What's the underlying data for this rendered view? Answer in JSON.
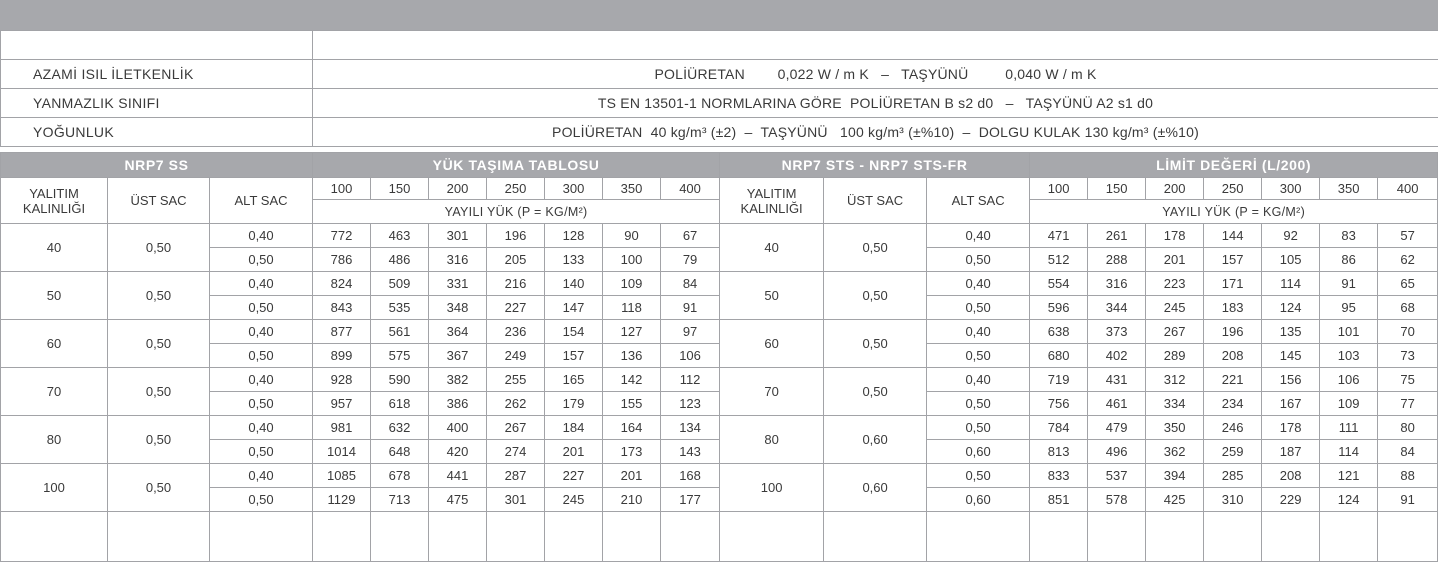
{
  "properties": [
    {
      "label": "AZAMİ ISIL İLETKENLİK",
      "value": "POLİÜRETAN        0,022 W / m K   –   TAŞYÜNÜ         0,040 W / m K"
    },
    {
      "label": "YANMAZLIK SINIFI",
      "value": "TS EN 13501-1 NORMLARINA GÖRE  POLİÜRETAN B s2 d0   –   TAŞYÜNÜ A2 s1 d0"
    },
    {
      "label": "YOĞUNLUK",
      "value": "POLİÜRETAN  40 kg/m³ (±2)  –  TAŞYÜNÜ   100 kg/m³ (±%10)  –  DOLGU KULAK 130 kg/m³ (±%10)"
    }
  ],
  "headers": {
    "left_product": "NRP7 SS",
    "left_table": "YÜK TAŞIMA TABLOSU",
    "right_product": "NRP7 STS - NRP7 STS-FR",
    "right_table": "LİMİT DEĞERİ (L/200)",
    "insulation": "YALITIM KALINLIĞI",
    "top_sheet": "ÜST SAC",
    "bottom_sheet": "ALT SAC",
    "spans": [
      "100",
      "150",
      "200",
      "250",
      "300",
      "350",
      "400"
    ],
    "load_label": "YAYILI YÜK (P = KG/M²)"
  },
  "left_groups": [
    {
      "thickness": "40",
      "top": "0,50",
      "rows": [
        {
          "bottom": "0,40",
          "values": [
            "772",
            "463",
            "301",
            "196",
            "128",
            "90",
            "67"
          ]
        },
        {
          "bottom": "0,50",
          "values": [
            "786",
            "486",
            "316",
            "205",
            "133",
            "100",
            "79"
          ]
        }
      ]
    },
    {
      "thickness": "50",
      "top": "0,50",
      "rows": [
        {
          "bottom": "0,40",
          "values": [
            "824",
            "509",
            "331",
            "216",
            "140",
            "109",
            "84"
          ]
        },
        {
          "bottom": "0,50",
          "values": [
            "843",
            "535",
            "348",
            "227",
            "147",
            "118",
            "91"
          ]
        }
      ]
    },
    {
      "thickness": "60",
      "top": "0,50",
      "rows": [
        {
          "bottom": "0,40",
          "values": [
            "877",
            "561",
            "364",
            "236",
            "154",
            "127",
            "97"
          ]
        },
        {
          "bottom": "0,50",
          "values": [
            "899",
            "575",
            "367",
            "249",
            "157",
            "136",
            "106"
          ]
        }
      ]
    },
    {
      "thickness": "70",
      "top": "0,50",
      "rows": [
        {
          "bottom": "0,40",
          "values": [
            "928",
            "590",
            "382",
            "255",
            "165",
            "142",
            "112"
          ]
        },
        {
          "bottom": "0,50",
          "values": [
            "957",
            "618",
            "386",
            "262",
            "179",
            "155",
            "123"
          ]
        }
      ]
    },
    {
      "thickness": "80",
      "top": "0,50",
      "rows": [
        {
          "bottom": "0,40",
          "values": [
            "981",
            "632",
            "400",
            "267",
            "184",
            "164",
            "134"
          ]
        },
        {
          "bottom": "0,50",
          "values": [
            "1014",
            "648",
            "420",
            "274",
            "201",
            "173",
            "143"
          ]
        }
      ]
    },
    {
      "thickness": "100",
      "top": "0,50",
      "rows": [
        {
          "bottom": "0,40",
          "values": [
            "1085",
            "678",
            "441",
            "287",
            "227",
            "201",
            "168"
          ]
        },
        {
          "bottom": "0,50",
          "values": [
            "1129",
            "713",
            "475",
            "301",
            "245",
            "210",
            "177"
          ]
        }
      ]
    }
  ],
  "right_groups": [
    {
      "thickness": "40",
      "top": "0,50",
      "rows": [
        {
          "bottom": "0,40",
          "values": [
            "471",
            "261",
            "178",
            "144",
            "92",
            "83",
            "57"
          ]
        },
        {
          "bottom": "0,50",
          "values": [
            "512",
            "288",
            "201",
            "157",
            "105",
            "86",
            "62"
          ]
        }
      ]
    },
    {
      "thickness": "50",
      "top": "0,50",
      "rows": [
        {
          "bottom": "0,40",
          "values": [
            "554",
            "316",
            "223",
            "171",
            "114",
            "91",
            "65"
          ]
        },
        {
          "bottom": "0,50",
          "values": [
            "596",
            "344",
            "245",
            "183",
            "124",
            "95",
            "68"
          ]
        }
      ]
    },
    {
      "thickness": "60",
      "top": "0,50",
      "rows": [
        {
          "bottom": "0,40",
          "values": [
            "638",
            "373",
            "267",
            "196",
            "135",
            "101",
            "70"
          ]
        },
        {
          "bottom": "0,50",
          "values": [
            "680",
            "402",
            "289",
            "208",
            "145",
            "103",
            "73"
          ]
        }
      ]
    },
    {
      "thickness": "70",
      "top": "0,50",
      "rows": [
        {
          "bottom": "0,40",
          "values": [
            "719",
            "431",
            "312",
            "221",
            "156",
            "106",
            "75"
          ]
        },
        {
          "bottom": "0,50",
          "values": [
            "756",
            "461",
            "334",
            "234",
            "167",
            "109",
            "77"
          ]
        }
      ]
    },
    {
      "thickness": "80",
      "top": "0,60",
      "rows": [
        {
          "bottom": "0,50",
          "values": [
            "784",
            "479",
            "350",
            "246",
            "178",
            "111",
            "80"
          ]
        },
        {
          "bottom": "0,60",
          "values": [
            "813",
            "496",
            "362",
            "259",
            "187",
            "114",
            "84"
          ]
        }
      ]
    },
    {
      "thickness": "100",
      "top": "0,60",
      "rows": [
        {
          "bottom": "0,50",
          "values": [
            "833",
            "537",
            "394",
            "285",
            "208",
            "121",
            "88"
          ]
        },
        {
          "bottom": "0,60",
          "values": [
            "851",
            "578",
            "425",
            "310",
            "229",
            "124",
            "91"
          ]
        }
      ]
    }
  ]
}
